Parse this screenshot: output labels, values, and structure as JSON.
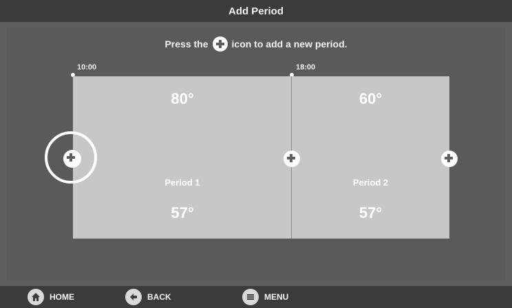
{
  "header": {
    "title": "Add Period"
  },
  "instruction": {
    "prefix": "Press the",
    "suffix": "icon to add a new period."
  },
  "timeline": {
    "start_times": [
      "10:00",
      "18:00"
    ]
  },
  "periods": [
    {
      "name": "Period 1",
      "heat": "80°",
      "cool": "57°"
    },
    {
      "name": "Period 2",
      "heat": "60°",
      "cool": "57°"
    }
  ],
  "nav": {
    "home": "HOME",
    "back": "BACK",
    "menu": "MENU"
  },
  "colors": {
    "background": "#5f5f5f",
    "bars": "#3b3b3b",
    "period_fill": "#c7c7c7",
    "text": "#ffffff"
  },
  "icons": [
    "plus-circle-icon",
    "home-icon",
    "back-arrow-icon",
    "menu-icon"
  ]
}
